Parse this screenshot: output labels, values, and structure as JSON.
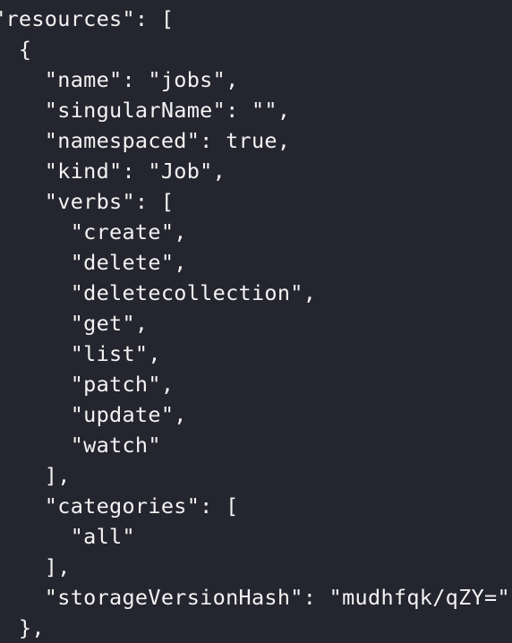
{
  "code": {
    "lines": [
      "\"resources\": [",
      "  {",
      "    \"name\": \"jobs\",",
      "    \"singularName\": \"\",",
      "    \"namespaced\": true,",
      "    \"kind\": \"Job\",",
      "    \"verbs\": [",
      "      \"create\",",
      "      \"delete\",",
      "      \"deletecollection\",",
      "      \"get\",",
      "      \"list\",",
      "      \"patch\",",
      "      \"update\",",
      "      \"watch\"",
      "    ],",
      "    \"categories\": [",
      "      \"all\"",
      "    ],",
      "    \"storageVersionHash\": \"mudhfqk/qZY=\"",
      "  },"
    ]
  },
  "colors": {
    "background": "#24252e",
    "text": "#f3f3f3"
  }
}
